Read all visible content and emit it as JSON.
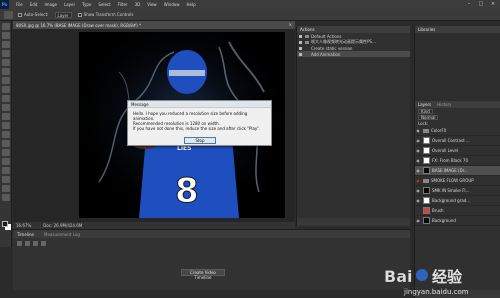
{
  "app": {
    "logo": "Ps",
    "menus": [
      "File",
      "Edit",
      "Image",
      "Layer",
      "Type",
      "Select",
      "Filter",
      "3D",
      "View",
      "Window",
      "Help"
    ]
  },
  "options": {
    "auto_select_label": "Auto-Select:",
    "auto_select_value": "Layer",
    "transform_label": "Show Transform Controls"
  },
  "document": {
    "tab_title": "80SX.jpg @ 16.7% (BASE IMAGE (Draw over mask), RGB/8#) *",
    "status_zoom": "16.67%",
    "status_doc": "Doc: 26.9M/424.6M"
  },
  "dialog": {
    "title": "Message",
    "line1": "Hello. I hope you reduced a resolution size before adding animation.",
    "line2": "Recommended resolution is 1280 on width.",
    "line3": "If you have not done this, reduce the size and after click \"Play\".",
    "ok_label": "Stop"
  },
  "actions": {
    "header": "Actions",
    "rows": [
      {
        "label": "Default Actions",
        "type": "folder",
        "selected": false
      },
      {
        "label": "帧大人像视频转光动画提示属性PS...",
        "type": "folder",
        "selected": false
      },
      {
        "label": "Create static version",
        "type": "action",
        "selected": false
      },
      {
        "label": "Add Animation",
        "type": "action",
        "selected": true
      }
    ]
  },
  "timeline": {
    "tab_timeline": "Timeline",
    "tab_measurement": "Measurement Log",
    "create_button": "Create Video Timeline"
  },
  "right": {
    "tab_libraries": "Libraries",
    "tab_layers": "Layers",
    "tab_history": "History",
    "kind_label": "Kind",
    "mode_label": "Normal",
    "lock_label": "Lock:",
    "layers": [
      {
        "name": "ColorFX",
        "type": "folder",
        "selected": false
      },
      {
        "name": "Overall Contrast ...",
        "type": "adj",
        "selected": false
      },
      {
        "name": "Overall Level",
        "type": "adj",
        "selected": false
      },
      {
        "name": "FX: From Black 70",
        "type": "adj",
        "selected": false
      },
      {
        "name": "BASE IMAGE (Dr...",
        "type": "image",
        "selected": true
      },
      {
        "name": "SMOKE FLOW GROUP",
        "type": "folder",
        "selected": false
      },
      {
        "name": "SMK IN Smoke Fl...",
        "type": "adj",
        "selected": false
      },
      {
        "name": "Background grad...",
        "type": "adj",
        "selected": false
      },
      {
        "name": "Brush",
        "type": "image",
        "selected": false
      },
      {
        "name": "Background",
        "type": "image",
        "selected": false
      }
    ]
  },
  "watermark": {
    "brand": "Bai",
    "brand_suffix": "经验",
    "url": "jingyan.baidu.com"
  },
  "colors": {
    "accent": "#31a8ff",
    "jersey": "#1f4fbf",
    "dialog_border": "#3c7fb1"
  }
}
